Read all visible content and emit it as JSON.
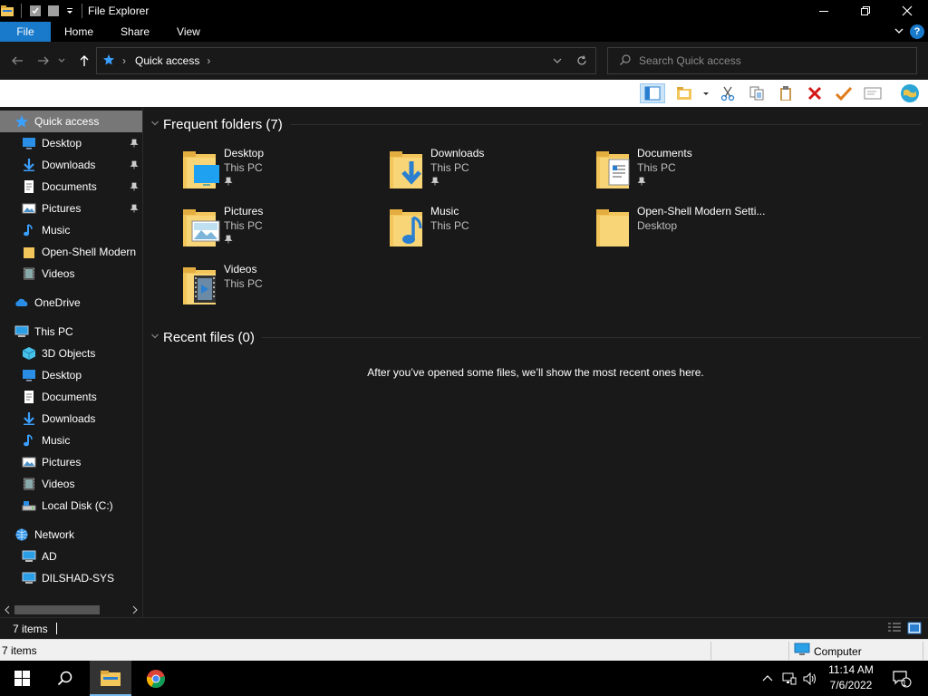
{
  "window": {
    "title": "File Explorer"
  },
  "ribbon": {
    "tabs": [
      "File",
      "Home",
      "Share",
      "View"
    ]
  },
  "address": {
    "location": "Quick access"
  },
  "search": {
    "placeholder": "Search Quick access"
  },
  "sidebar": {
    "items": [
      {
        "label": "Quick access",
        "icon": "star-icon",
        "pinned": false
      },
      {
        "label": "Desktop",
        "icon": "desktop-icon",
        "pinned": true
      },
      {
        "label": "Downloads",
        "icon": "download-icon",
        "pinned": true
      },
      {
        "label": "Documents",
        "icon": "document-icon",
        "pinned": true
      },
      {
        "label": "Pictures",
        "icon": "pictures-icon",
        "pinned": true
      },
      {
        "label": "Music",
        "icon": "music-icon",
        "pinned": false
      },
      {
        "label": "Open-Shell Modern",
        "icon": "folder-icon",
        "pinned": false
      },
      {
        "label": "Videos",
        "icon": "video-icon",
        "pinned": false
      },
      {
        "label": "OneDrive",
        "icon": "cloud-icon",
        "pinned": false
      },
      {
        "label": "This PC",
        "icon": "computer-icon",
        "pinned": false
      },
      {
        "label": "3D Objects",
        "icon": "cube-icon",
        "pinned": false
      },
      {
        "label": "Desktop",
        "icon": "desktop-icon",
        "pinned": false
      },
      {
        "label": "Documents",
        "icon": "document-icon",
        "pinned": false
      },
      {
        "label": "Downloads",
        "icon": "download-icon",
        "pinned": false
      },
      {
        "label": "Music",
        "icon": "music-icon",
        "pinned": false
      },
      {
        "label": "Pictures",
        "icon": "pictures-icon",
        "pinned": false
      },
      {
        "label": "Videos",
        "icon": "video-icon",
        "pinned": false
      },
      {
        "label": "Local Disk (C:)",
        "icon": "drive-icon",
        "pinned": false
      },
      {
        "label": "Network",
        "icon": "network-icon",
        "pinned": false
      },
      {
        "label": "AD",
        "icon": "computer-icon",
        "pinned": false
      },
      {
        "label": "DILSHAD-SYS",
        "icon": "computer-icon",
        "pinned": false
      }
    ]
  },
  "content": {
    "frequent_title": "Frequent folders (7)",
    "recent_title": "Recent files (0)",
    "empty_message": "After you’ve opened some files, we’ll show the most recent ones here.",
    "folders": [
      {
        "name": "Desktop",
        "location": "This PC",
        "pinned": true,
        "icon": "desktop-folder-icon"
      },
      {
        "name": "Downloads",
        "location": "This PC",
        "pinned": true,
        "icon": "downloads-folder-icon"
      },
      {
        "name": "Documents",
        "location": "This PC",
        "pinned": true,
        "icon": "documents-folder-icon"
      },
      {
        "name": "Pictures",
        "location": "This PC",
        "pinned": true,
        "icon": "pictures-folder-icon"
      },
      {
        "name": "Music",
        "location": "This PC",
        "pinned": false,
        "icon": "music-folder-icon"
      },
      {
        "name": "Open-Shell Modern Setti...",
        "location": "Desktop",
        "pinned": false,
        "icon": "folder-icon"
      },
      {
        "name": "Videos",
        "location": "This PC",
        "pinned": false,
        "icon": "videos-folder-icon"
      }
    ]
  },
  "status": {
    "items_count": "7 items",
    "classic_items": "7 items",
    "zone": "Computer"
  },
  "taskbar": {
    "time": "11:14 AM",
    "date": "7/6/2022",
    "notifications": "1"
  },
  "colors": {
    "accent": "#1979ca",
    "folder": "#f3c65c",
    "background": "#191919",
    "selected": "#777777"
  }
}
